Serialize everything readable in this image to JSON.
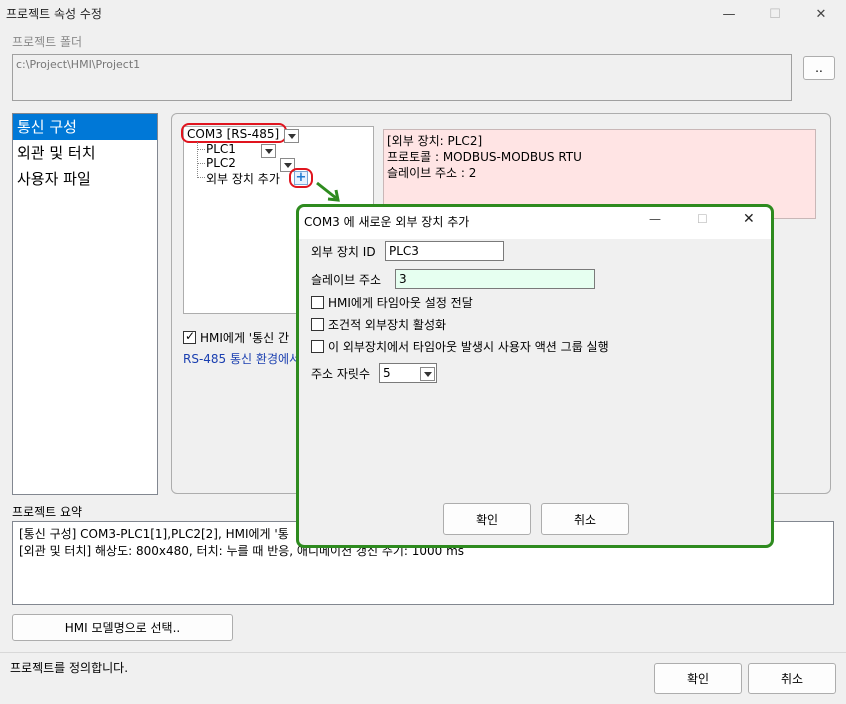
{
  "window": {
    "title": "프로젝트 속성 수정",
    "minimize": "—",
    "maximize": "☐",
    "close": "✕"
  },
  "project_folder": {
    "label": "프로젝트 폴더",
    "path": "c:\\Project\\HMI\\Project1",
    "browse_label": ".."
  },
  "sidebar": {
    "items": [
      {
        "label": "통신 구성",
        "selected": true
      },
      {
        "label": "외관 및 터치",
        "selected": false
      },
      {
        "label": "사용자 파일",
        "selected": false
      }
    ]
  },
  "tree": {
    "port": "COM3 [RS-485]",
    "devices": [
      "PLC1",
      "PLC2"
    ],
    "add_device_label": "외부 장치 추가",
    "add_icon": "plus-icon"
  },
  "device_info": {
    "line1": "[외부 장치: PLC2]",
    "line2": "프로토콜 : MODBUS-MODBUS RTU",
    "line3": "슬레이브 주소 : 2"
  },
  "comm_options": {
    "hmi_timeout_label": "HMI에게 '통신 간",
    "hmi_timeout_checked": true,
    "rs485_note": "RS-485 통신 환경에서"
  },
  "summary": {
    "label": "프로젝트 요약",
    "line1": "[통신 구성] COM3-PLC1[1],PLC2[2], HMI에게 '통",
    "line2": "[외관 및 터치] 해상도: 800x480, 터치: 누를 때 반응, 애니메이션 갱신 주기: 1000 ms"
  },
  "model_button": "HMI 모델명으로 선택..",
  "status_text": "프로젝트를 정의합니다.",
  "footer": {
    "ok": "확인",
    "cancel": "취소"
  },
  "dialog": {
    "title": "COM3 에 새로운 외부 장치 추가",
    "device_id_label": "외부 장치 ID",
    "device_id_value": "PLC3",
    "slave_addr_label": "슬레이브 주소",
    "slave_addr_value": "3",
    "checkboxes": [
      {
        "label": "HMI에게 타임아웃 설정 전달",
        "checked": false
      },
      {
        "label": "조건적 외부장치 활성화",
        "checked": false
      },
      {
        "label": "이 외부장치에서 타임아웃 발생시 사용자 액션 그룹 실행",
        "checked": false
      }
    ],
    "addr_digits_label": "주소 자릿수",
    "addr_digits_value": "5",
    "ok": "확인",
    "cancel": "취소",
    "minimize": "—",
    "maximize": "☐",
    "close": "✕"
  },
  "colors": {
    "highlight_red": "#e0141e",
    "dialog_border_green": "#2e8b1f",
    "selection_blue": "#0078d7",
    "info_pink": "#ffe4e4",
    "note_blue": "#1a3fb0"
  }
}
